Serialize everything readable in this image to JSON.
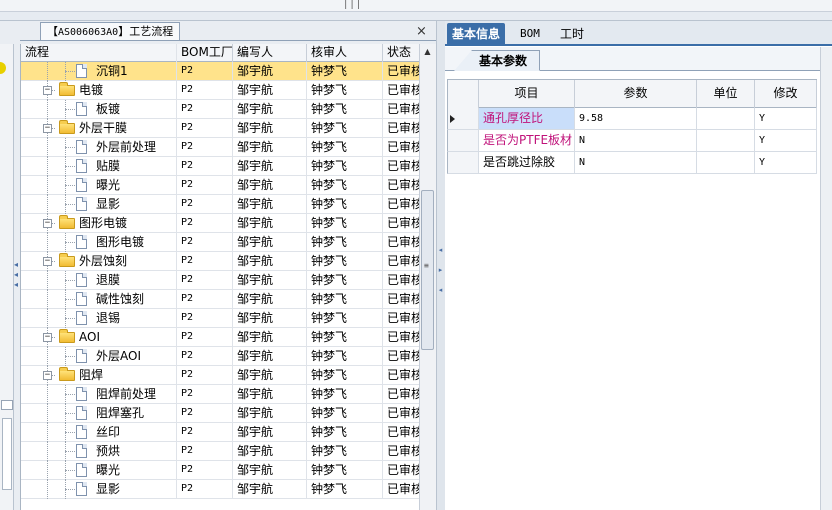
{
  "top_grip": "|||",
  "left_tab": {
    "bracket_open": "【",
    "code": "AS006063A0",
    "bracket_close": "】",
    "name": "工艺流程",
    "close_glyph": "×"
  },
  "tree": {
    "columns": [
      "流程",
      "BOM工厂",
      "编写人",
      "核审人",
      "状态"
    ],
    "rows": [
      {
        "level": 2,
        "type": "doc",
        "name": "沉铜1",
        "bom": "P2",
        "writer": "邹宇航",
        "reviewer": "钟梦飞",
        "status": "已审核",
        "selected": true
      },
      {
        "level": 1,
        "type": "folder",
        "name": "电镀",
        "bom": "P2",
        "writer": "邹宇航",
        "reviewer": "钟梦飞",
        "status": "已审核"
      },
      {
        "level": 2,
        "type": "doc",
        "name": "板镀",
        "bom": "P2",
        "writer": "邹宇航",
        "reviewer": "钟梦飞",
        "status": "已审核"
      },
      {
        "level": 1,
        "type": "folder",
        "name": "外层干膜",
        "bom": "P2",
        "writer": "邹宇航",
        "reviewer": "钟梦飞",
        "status": "已审核"
      },
      {
        "level": 2,
        "type": "doc",
        "name": "外层前处理",
        "bom": "P2",
        "writer": "邹宇航",
        "reviewer": "钟梦飞",
        "status": "已审核"
      },
      {
        "level": 2,
        "type": "doc",
        "name": "贴膜",
        "bom": "P2",
        "writer": "邹宇航",
        "reviewer": "钟梦飞",
        "status": "已审核"
      },
      {
        "level": 2,
        "type": "doc",
        "name": "曝光",
        "bom": "P2",
        "writer": "邹宇航",
        "reviewer": "钟梦飞",
        "status": "已审核"
      },
      {
        "level": 2,
        "type": "doc",
        "name": "显影",
        "bom": "P2",
        "writer": "邹宇航",
        "reviewer": "钟梦飞",
        "status": "已审核"
      },
      {
        "level": 1,
        "type": "folder",
        "name": "图形电镀",
        "bom": "P2",
        "writer": "邹宇航",
        "reviewer": "钟梦飞",
        "status": "已审核"
      },
      {
        "level": 2,
        "type": "doc",
        "name": "图形电镀",
        "bom": "P2",
        "writer": "邹宇航",
        "reviewer": "钟梦飞",
        "status": "已审核"
      },
      {
        "level": 1,
        "type": "folder",
        "name": "外层蚀刻",
        "bom": "P2",
        "writer": "邹宇航",
        "reviewer": "钟梦飞",
        "status": "已审核"
      },
      {
        "level": 2,
        "type": "doc",
        "name": "退膜",
        "bom": "P2",
        "writer": "邹宇航",
        "reviewer": "钟梦飞",
        "status": "已审核"
      },
      {
        "level": 2,
        "type": "doc",
        "name": "碱性蚀刻",
        "bom": "P2",
        "writer": "邹宇航",
        "reviewer": "钟梦飞",
        "status": "已审核"
      },
      {
        "level": 2,
        "type": "doc",
        "name": "退锡",
        "bom": "P2",
        "writer": "邹宇航",
        "reviewer": "钟梦飞",
        "status": "已审核"
      },
      {
        "level": 1,
        "type": "folder",
        "name": "AOI",
        "bom": "P2",
        "writer": "邹宇航",
        "reviewer": "钟梦飞",
        "status": "已审核"
      },
      {
        "level": 2,
        "type": "doc",
        "name": "外层AOI",
        "bom": "P2",
        "writer": "邹宇航",
        "reviewer": "钟梦飞",
        "status": "已审核"
      },
      {
        "level": 1,
        "type": "folder",
        "name": "阻焊",
        "bom": "P2",
        "writer": "邹宇航",
        "reviewer": "钟梦飞",
        "status": "已审核"
      },
      {
        "level": 2,
        "type": "doc",
        "name": "阻焊前处理",
        "bom": "P2",
        "writer": "邹宇航",
        "reviewer": "钟梦飞",
        "status": "已审核"
      },
      {
        "level": 2,
        "type": "doc",
        "name": "阻焊塞孔",
        "bom": "P2",
        "writer": "邹宇航",
        "reviewer": "钟梦飞",
        "status": "已审核"
      },
      {
        "level": 2,
        "type": "doc",
        "name": "丝印",
        "bom": "P2",
        "writer": "邹宇航",
        "reviewer": "钟梦飞",
        "status": "已审核"
      },
      {
        "level": 2,
        "type": "doc",
        "name": "预烘",
        "bom": "P2",
        "writer": "邹宇航",
        "reviewer": "钟梦飞",
        "status": "已审核"
      },
      {
        "level": 2,
        "type": "doc",
        "name": "曝光",
        "bom": "P2",
        "writer": "邹宇航",
        "reviewer": "钟梦飞",
        "status": "已审核"
      },
      {
        "level": 2,
        "type": "doc",
        "name": "显影",
        "bom": "P2",
        "writer": "邹宇航",
        "reviewer": "钟梦飞",
        "status": "已审核"
      }
    ]
  },
  "right_tabs": [
    "基本信息",
    "BOM",
    "工时"
  ],
  "sub_tab": "基本参数",
  "param_grid": {
    "columns": [
      "项目",
      "参数",
      "单位",
      "修改"
    ],
    "rows": [
      {
        "item": "通孔厚径比",
        "param": "9.58",
        "unit": "",
        "modify": "Y",
        "pink": true,
        "current": true
      },
      {
        "item": "是否为PTFE板材",
        "param": "N",
        "unit": "",
        "modify": "Y",
        "pink": true,
        "current": false
      },
      {
        "item": "是否跳过除胶",
        "param": "N",
        "unit": "",
        "modify": "Y",
        "pink": false,
        "current": false
      }
    ]
  },
  "colors": {
    "selected_row": "#ffe38b",
    "active_tab": "#3b6ea8",
    "pink_text": "#c0127a",
    "item_highlight": "#c9defa"
  }
}
